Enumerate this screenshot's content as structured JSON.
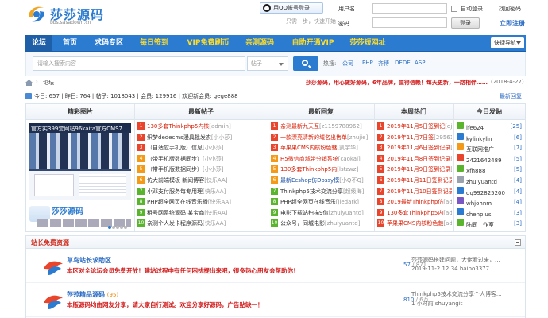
{
  "header": {
    "logo_text": "莎莎源码",
    "logo_sub": "bbs.sasadown.cn",
    "qq_button": "用QQ帐号登录",
    "qq_note": "只需一步，快速开始",
    "username_label": "用户名",
    "password_label": "密码",
    "auto_login": "自动登录",
    "forgot": "找回密码",
    "login_button": "登录",
    "register": "立即注册"
  },
  "nav": {
    "items": [
      "论坛",
      "首页",
      "求码专区",
      "每日签到",
      "VIP免费刷币",
      "亲测源码",
      "自助开通VIP",
      "莎莎短网址"
    ],
    "quick": "快捷导航"
  },
  "search": {
    "placeholder": "请输入搜索内容",
    "type": "帖子",
    "hot_label": "热搜:",
    "hot": [
      "公司",
      "PHP",
      "齐博",
      "DEDE",
      "ASP"
    ]
  },
  "breadcrumb": {
    "current": "论坛",
    "slogan": "莎莎源码，用心做好源码，6年品牌，值得信赖！每天更新，一路相伴……",
    "date": "(2018-4-27)"
  },
  "stats": {
    "text": "今日: 657 | 昨日: 764 | 帖子: 1018043 | 会员: 129916 | 欢迎新会员: gege888",
    "latest": "最新回复"
  },
  "grid": {
    "headers": [
      "精彩图片",
      "最新帖子",
      "最新回复",
      "本周热门",
      "今日发贴"
    ],
    "pic_caption": "官方实399套网站96kaifa官方CMS7...",
    "pic_logo": "莎莎源码",
    "new_posts": [
      {
        "n": "1",
        "title": "130多套Thinkphp5内核",
        "author": "[admin]",
        "style": "red"
      },
      {
        "n": "2",
        "title": "织梦dedecms漫具批发农",
        "author": "[小小莎]",
        "style": ""
      },
      {
        "n": "3",
        "title": "（自适应手机版）信息",
        "author": "[小小莎]",
        "style": ""
      },
      {
        "n": "4",
        "title": "（带手机版数据同步）",
        "author": "[小小莎]",
        "style": ""
      },
      {
        "n": "5",
        "title": "（带手机版数据同步）",
        "author": "[小小莎]",
        "style": ""
      },
      {
        "n": "6",
        "title": "仿大前端模板 新闻博客",
        "author": "[快乐AA]",
        "style": ""
      },
      {
        "n": "7",
        "title": "小邓支付服务每专用理",
        "author": "[快乐AA]",
        "style": ""
      },
      {
        "n": "8",
        "title": "PHP超全网页在线音乐播",
        "author": "[快乐AA]",
        "style": ""
      },
      {
        "n": "9",
        "title": "租号网系统源码 某宝商",
        "author": "[快乐AA]",
        "style": ""
      },
      {
        "n": "10",
        "title": "亲测个人发卡程序源码",
        "author": "[快乐AA]",
        "style": ""
      }
    ],
    "new_replies": [
      {
        "n": "1",
        "title": "亲测最新九天互",
        "author": "[z1159788962]",
        "style": "red"
      },
      {
        "n": "2",
        "title": "一款漂亮清新的域名出售单",
        "author": "[zhujie]",
        "style": "red"
      },
      {
        "n": "3",
        "title": "苹果果CMS内核粉色魅",
        "author": "[凯宇华]",
        "style": "red"
      },
      {
        "n": "4",
        "title": "H5微信商城带分销系统",
        "author": "[caokai]",
        "style": "red"
      },
      {
        "n": "5",
        "title": "130多套Thinkphp5内",
        "author": "[lstzwz]",
        "style": "red"
      },
      {
        "n": "6",
        "title": "最新Ecshop仿Dossy模",
        "author": "[小Q不Q]",
        "style": "blue"
      },
      {
        "n": "7",
        "title": "Thinkphp5技术交流分享",
        "author": "[超级海]",
        "style": ""
      },
      {
        "n": "8",
        "title": "PHP超全网页在线音乐",
        "author": "[jiedark]",
        "style": ""
      },
      {
        "n": "9",
        "title": "电影下载站扫描9你",
        "author": "[zhuiyuantd]",
        "style": ""
      },
      {
        "n": "10",
        "title": "公众号，同城电影",
        "author": "[zhuiyuantd]",
        "style": ""
      }
    ],
    "weekly_hot": [
      {
        "n": "1",
        "title": "2019年11月5日签到记",
        "author": "[djsimba]",
        "style": "red"
      },
      {
        "n": "2",
        "title": "2019年11月7日签",
        "author": "[295618919]",
        "style": "red"
      },
      {
        "n": "3",
        "title": "2019年11月6日签到记录",
        "author": "[shuyangit]",
        "style": "red"
      },
      {
        "n": "4",
        "title": "2019年11月8日签到记录",
        "author": "[928910200]",
        "style": "red"
      },
      {
        "n": "5",
        "title": "2019年11月9日签到记录",
        "author": "[deke]",
        "style": "red"
      },
      {
        "n": "6",
        "title": "2019年11月11日签到记录",
        "author": "[admin]",
        "style": "red"
      },
      {
        "n": "7",
        "title": "2019年11月10日签到记录",
        "author": "[xfh888]",
        "style": "red"
      },
      {
        "n": "8",
        "title": "2019最新Thinkphp仿",
        "author": "[admin]",
        "style": "red"
      },
      {
        "n": "9",
        "title": "130多套Thinkphp5内",
        "author": "[admin]",
        "style": "red"
      },
      {
        "n": "10",
        "title": "苹果果CMS内核粉色魅",
        "author": "[admin]",
        "style": "red"
      }
    ],
    "today_posters": [
      {
        "name": "lfe624",
        "count": "[25]",
        "color": "#5ab42d"
      },
      {
        "name": "kylinkylin",
        "count": "[6]",
        "color": "#2b7bd0"
      },
      {
        "name": "互联网推广",
        "count": "[7]",
        "color": "#f39b18"
      },
      {
        "name": "2421642489",
        "count": "[5]",
        "color": "#e8452c"
      },
      {
        "name": "xfh888",
        "count": "[5]",
        "color": "#5ab42d"
      },
      {
        "name": "zhuiyuantd",
        "count": "[4]",
        "color": "#9aa3ad"
      },
      {
        "name": "qq992825200",
        "count": "[4]",
        "color": "#2b7bd0"
      },
      {
        "name": "whjohnm",
        "count": "[4]",
        "color": "#7a58c4"
      },
      {
        "name": "chenplus",
        "count": "[3]",
        "color": "#2b7bd0"
      },
      {
        "name": "陆同工作室",
        "count": "[3]",
        "color": "#5ab42d"
      }
    ]
  },
  "board": {
    "title": "站长免费资源",
    "forums": [
      {
        "name": "草鸟站长求助区",
        "count": "",
        "desc": "本区对全论坛会员免费开放！建站过程中有任何困扰提出来吧，很多热心朋友会帮助你！",
        "threads": "57",
        "posts": "871",
        "last_title": "莎莎源码搭建问题，大佬看过来，...",
        "last_meta": "2019-11-2 12:34 haibo3377"
      },
      {
        "name": "莎莎精品源码",
        "count": "(95)",
        "desc": "本版源码均由网友分享，请大家自行测试。欢迎分享好源码，广告贴缺一！",
        "threads": "810",
        "posts": "6万",
        "last_title": "Thinkphp5技术交流分享个人博客...",
        "last_meta": "1 小时前 shuyangit"
      }
    ]
  },
  "colors": {
    "accent": "#2b7bd0",
    "nav_active": "#1f5fa8",
    "red": "#d81e06",
    "yellow": "#ffde2a"
  }
}
